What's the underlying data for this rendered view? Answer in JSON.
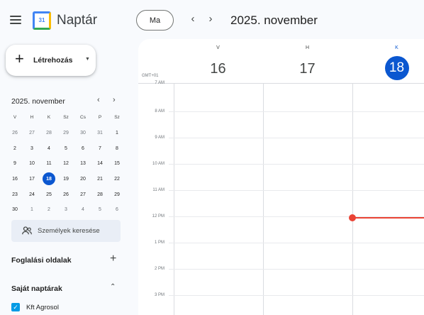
{
  "header": {
    "app_title": "Naptár",
    "today_label": "Ma",
    "prev_glyph": "‹",
    "next_glyph": "›",
    "period_title": "2025. november",
    "logo_day": "31"
  },
  "sidebar": {
    "create_label": "Létrehozás",
    "mini_calendar": {
      "title": "2025. november",
      "weekdays": [
        "V",
        "H",
        "K",
        "Sz",
        "Cs",
        "P",
        "Sz"
      ],
      "weeks": [
        [
          "26",
          "27",
          "28",
          "29",
          "30",
          "31",
          "1"
        ],
        [
          "2",
          "3",
          "4",
          "5",
          "6",
          "7",
          "8"
        ],
        [
          "9",
          "10",
          "11",
          "12",
          "13",
          "14",
          "15"
        ],
        [
          "16",
          "17",
          "18",
          "19",
          "20",
          "21",
          "22"
        ],
        [
          "23",
          "24",
          "25",
          "26",
          "27",
          "28",
          "29"
        ],
        [
          "30",
          "1",
          "2",
          "3",
          "4",
          "5",
          "6"
        ]
      ],
      "selected_day": "18"
    },
    "people_search_placeholder": "Személyek keresése",
    "booking_pages_label": "Foglalási oldalak",
    "my_calendars_label": "Saját naptárak",
    "calendars": [
      {
        "name": "Kft Agrosol",
        "checked": true,
        "color": "#039be5"
      }
    ]
  },
  "week_view": {
    "timezone": "GMT+01",
    "days": [
      {
        "weekday": "V",
        "date": "16",
        "today": false
      },
      {
        "weekday": "H",
        "date": "17",
        "today": false
      },
      {
        "weekday": "K",
        "date": "18",
        "today": true
      }
    ],
    "hours": [
      "7 AM",
      "8 AM",
      "9 AM",
      "10 AM",
      "11 AM",
      "12 PM",
      "1 PM",
      "2 PM",
      "3 PM"
    ]
  },
  "colors": {
    "accent": "#0b57d0",
    "now_indicator": "#ea4335",
    "background": "#f8fafd"
  }
}
